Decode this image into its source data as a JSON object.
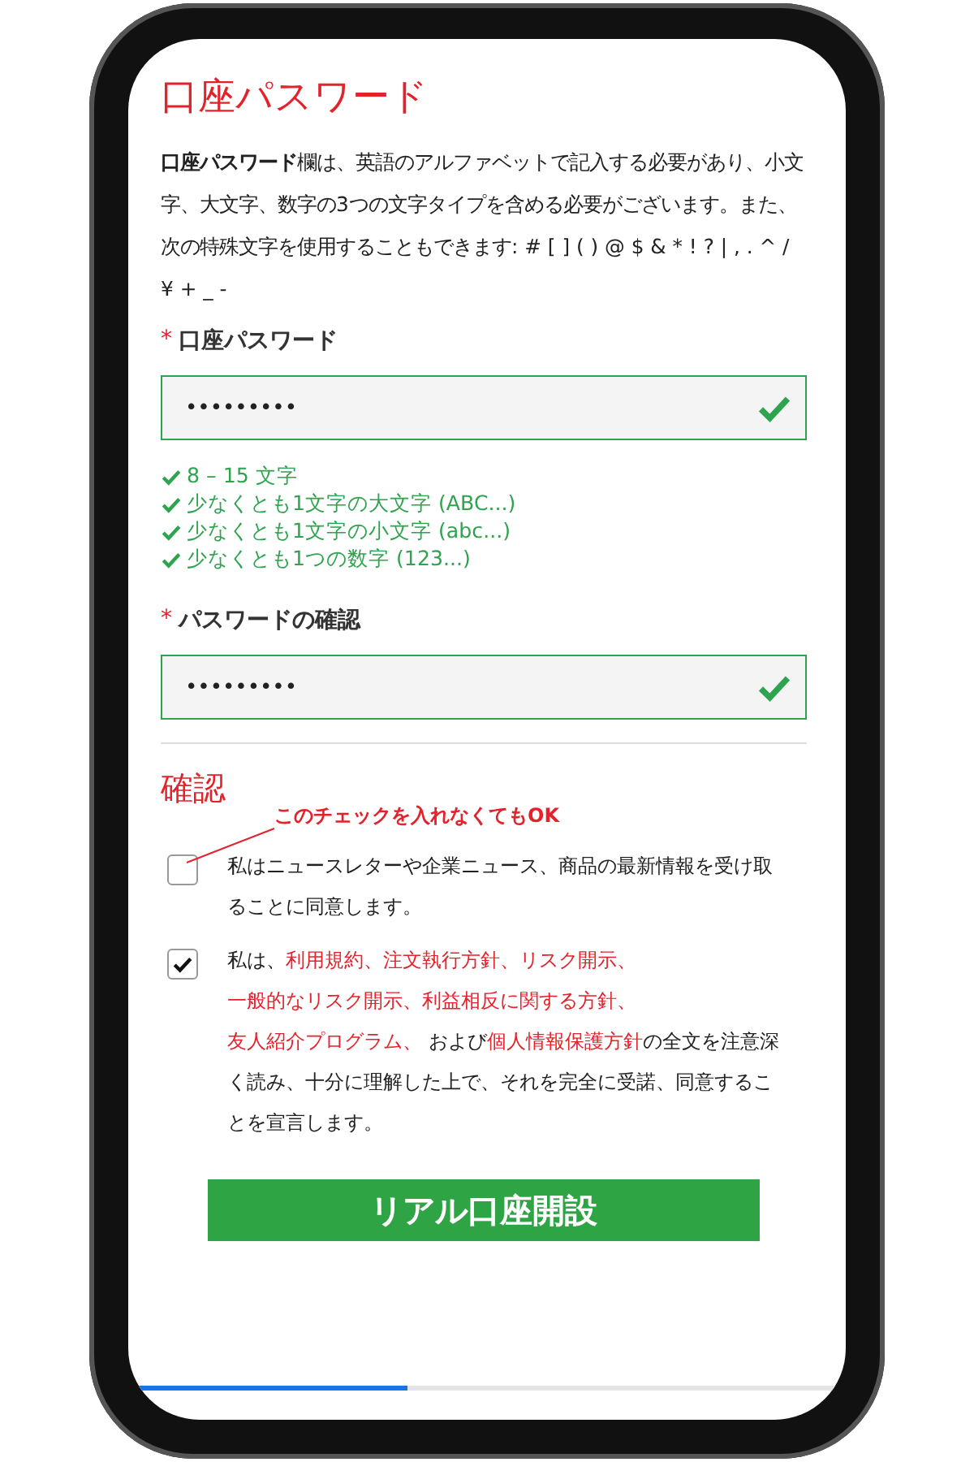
{
  "title": "口座パスワード",
  "intro": "**口座パスワード**欄は、英語のアルファベットで記入する必要があり、小文字、大文字、数字の3つの文字タイプを含める必要がございます。また、次の特殊文字を使用することもできます: # [ ] ( ) @ $ & * ! ? | , . ^ / ¥ + _ -",
  "fields": [
    {
      "label": "口座パスワード",
      "marker": "*",
      "value": "•••••••••",
      "valid": true,
      "rules": [
        {
          "text": "8 – 15 文字",
          "met": true
        },
        {
          "text": "少なくとも1文字の大文字 (ABC...)",
          "met": true
        },
        {
          "text": "少なくとも1文字の小文字 (abc...)",
          "met": true
        },
        {
          "text": "少なくとも1つの数字 (123...)",
          "met": true
        }
      ]
    },
    {
      "label": "パスワードの確認",
      "marker": "*",
      "value": "•••••••••",
      "valid": true
    }
  ],
  "confirm": {
    "heading": "確認",
    "annotation": "このチェックを入れなくてもOK",
    "items": [
      {
        "checked": false,
        "parts": [
          {
            "kind": "text",
            "text": "私はニュースレターや企業ニュース、商品の最新情報を受け取ることに同意します。"
          }
        ]
      },
      {
        "checked": true,
        "parts": [
          {
            "kind": "text",
            "text": "私は、"
          },
          {
            "kind": "link",
            "text": "利用規約"
          },
          {
            "kind": "link",
            "text": "、"
          },
          {
            "kind": "link",
            "text": "注文執行方針"
          },
          {
            "kind": "link",
            "text": "、"
          },
          {
            "kind": "link",
            "text": "リスク開示"
          },
          {
            "kind": "link",
            "text": "、"
          },
          {
            "kind": "link",
            "text": "一般的なリスク開示"
          },
          {
            "kind": "link",
            "text": "、"
          },
          {
            "kind": "link",
            "text": "利益相反に関する方針"
          },
          {
            "kind": "link",
            "text": "、"
          },
          {
            "kind": "link",
            "text": "友人紹介プログラム"
          },
          {
            "kind": "link",
            "text": "、"
          },
          {
            "kind": "text",
            "text": " および"
          },
          {
            "kind": "link",
            "text": "個人情報保護方針"
          },
          {
            "kind": "text",
            "text": "の全文を注意深く読み、十分に理解した上で、それを完全に受諾、同意することを宣言します。"
          }
        ]
      }
    ]
  },
  "submit": "リアル口座開設",
  "progress": {
    "level": 0.39
  }
}
